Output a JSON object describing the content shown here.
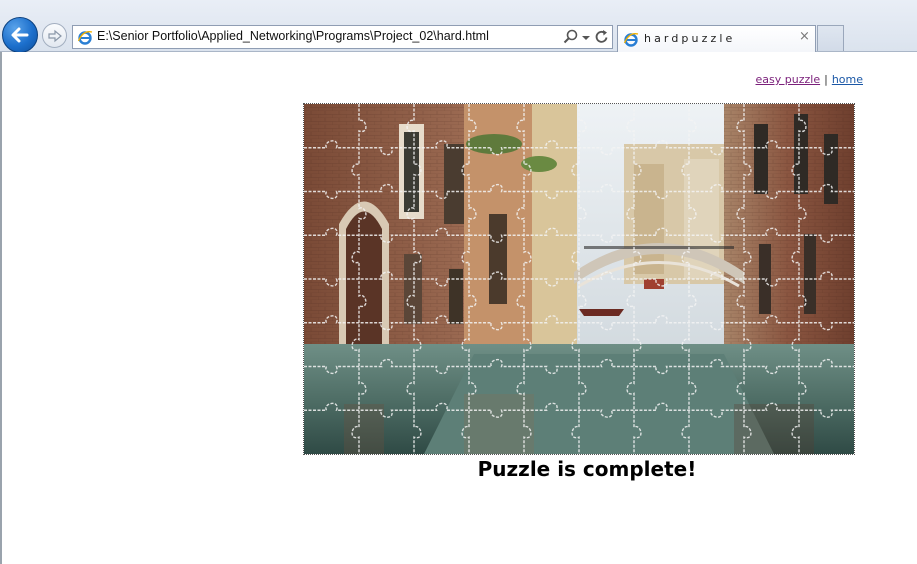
{
  "browser": {
    "address": "E:\\Senior Portfolio\\Applied_Networking\\Programs\\Project_02\\hard.html",
    "tab_title": "hardpuzzle",
    "tab_close_glyph": "×",
    "icons": [
      "back-arrow-icon",
      "forward-arrow-icon",
      "ie-favicon-icon",
      "search-icon",
      "dropdown-arrow-icon",
      "refresh-icon",
      "close-icon"
    ]
  },
  "page": {
    "links": {
      "easy_label": "easy puzzle",
      "separator": "|",
      "home_label": "home"
    },
    "puzzle": {
      "image_subject": "venice-canal",
      "columns": 10,
      "rows": 8
    },
    "status_message": "Puzzle is complete!"
  },
  "colors": {
    "back_button": "#1c6fcc",
    "visited_link": "#7a1f7a",
    "link": "#1a57a6"
  }
}
